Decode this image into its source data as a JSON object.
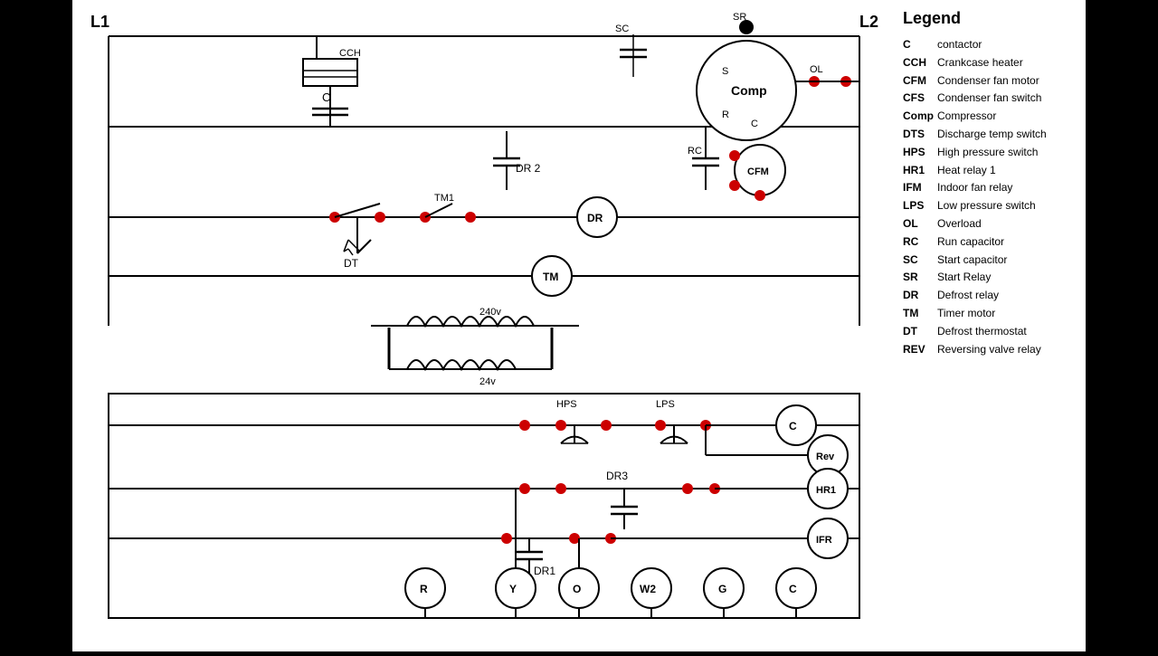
{
  "legend": {
    "title": "Legend",
    "items": [
      {
        "abbr": "C",
        "desc": "contactor"
      },
      {
        "abbr": "CCH",
        "desc": "Crankcase heater"
      },
      {
        "abbr": "CFM",
        "desc": "Condenser fan motor"
      },
      {
        "abbr": "CFS",
        "desc": "Condenser fan switch"
      },
      {
        "abbr": "Comp",
        "desc": "Compressor"
      },
      {
        "abbr": "DTS",
        "desc": "Discharge temp switch"
      },
      {
        "abbr": "HPS",
        "desc": "High pressure switch"
      },
      {
        "abbr": "HR1",
        "desc": "Heat relay 1"
      },
      {
        "abbr": "IFM",
        "desc": "Indoor fan relay"
      },
      {
        "abbr": "LPS",
        "desc": "Low pressure switch"
      },
      {
        "abbr": "OL",
        "desc": "Overload"
      },
      {
        "abbr": "RC",
        "desc": "Run capacitor"
      },
      {
        "abbr": "SC",
        "desc": "Start capacitor"
      },
      {
        "abbr": "SR",
        "desc": "Start Relay"
      },
      {
        "abbr": "DR",
        "desc": "Defrost relay"
      },
      {
        "abbr": "TM",
        "desc": "Timer motor"
      },
      {
        "abbr": "DT",
        "desc": "Defrost thermostat"
      },
      {
        "abbr": "REV",
        "desc": "Reversing valve relay"
      }
    ]
  },
  "diagram": {
    "L1": "L1",
    "L2": "L2",
    "labels": {
      "CCH": "CCH",
      "C": "C",
      "DR2": "DR 2",
      "TM1": "TM1",
      "DR": "DR",
      "TM": "TM",
      "v240": "240v",
      "v24": "24v",
      "DT": "DT",
      "SR": "SR",
      "SC": "SC",
      "RC": "RC",
      "Comp": "Comp",
      "OL": "OL",
      "CFM": "CFM",
      "HPS": "HPS",
      "LPS": "LPS",
      "DR3": "DR3",
      "DR1": "DR1",
      "Rev": "Rev",
      "HR1": "HR1",
      "IFR": "IFR",
      "Y": "Y",
      "O": "O",
      "W2": "W2",
      "G": "G",
      "Cbottom": "C",
      "R": "R"
    }
  }
}
